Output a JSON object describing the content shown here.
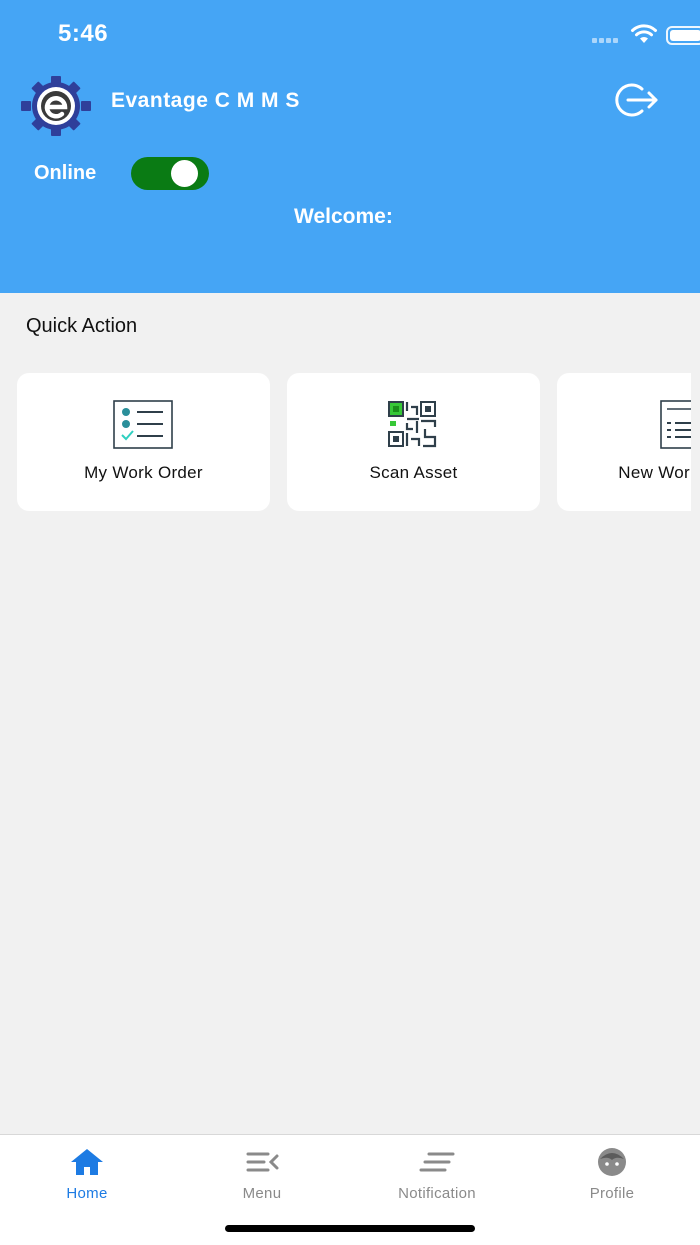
{
  "status_bar": {
    "time": "5:46"
  },
  "header": {
    "app_title": "Evantage C M M S",
    "online_label": "Online",
    "online_enabled": true,
    "welcome_text": "Welcome:"
  },
  "quick_action": {
    "title": "Quick Action",
    "cards": [
      {
        "label": "My Work Order",
        "icon": "checklist-icon"
      },
      {
        "label": "Scan Asset",
        "icon": "qr-code-icon"
      },
      {
        "label": "New Work Order",
        "icon": "document-icon"
      }
    ]
  },
  "tabbar": {
    "items": [
      {
        "label": "Home",
        "icon": "home-icon",
        "active": true
      },
      {
        "label": "Menu",
        "icon": "menu-icon",
        "active": false
      },
      {
        "label": "Notification",
        "icon": "notification-icon",
        "active": false
      },
      {
        "label": "Profile",
        "icon": "profile-icon",
        "active": false
      }
    ]
  },
  "colors": {
    "header_bg": "#45a5f5",
    "toggle_on": "#0a7b14",
    "active_tab": "#1d7be3",
    "page_bg": "#f1f1f1"
  }
}
